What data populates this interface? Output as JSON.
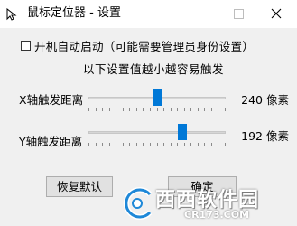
{
  "window": {
    "title": "鼠标定位器 - 设置"
  },
  "settings": {
    "autostart_label": "开机自动启动（可能需要管理员身份设置）",
    "autostart_checked": false,
    "hint": "以下设置值越小越容易触发"
  },
  "sliders": [
    {
      "label": "X轴触发距离",
      "value": 240,
      "unit": "像素",
      "display": "240  像素",
      "fraction": 0.5
    },
    {
      "label": "Y轴触发距离",
      "value": 192,
      "unit": "像素",
      "display": "192  像素",
      "fraction": 0.7
    }
  ],
  "buttons": {
    "reset_label": "恢复默认",
    "ok_label": "确定"
  },
  "watermark": {
    "brand": "西西软件园",
    "url": "CR173.COM"
  },
  "colors": {
    "accent": "#0078d7",
    "window_bg": "#f0f0f0",
    "title_bg": "#ffffff"
  },
  "icons": {
    "app": "cursor-icon",
    "minimize": "minimize-icon",
    "maximize": "maximize-icon",
    "close": "close-icon"
  }
}
